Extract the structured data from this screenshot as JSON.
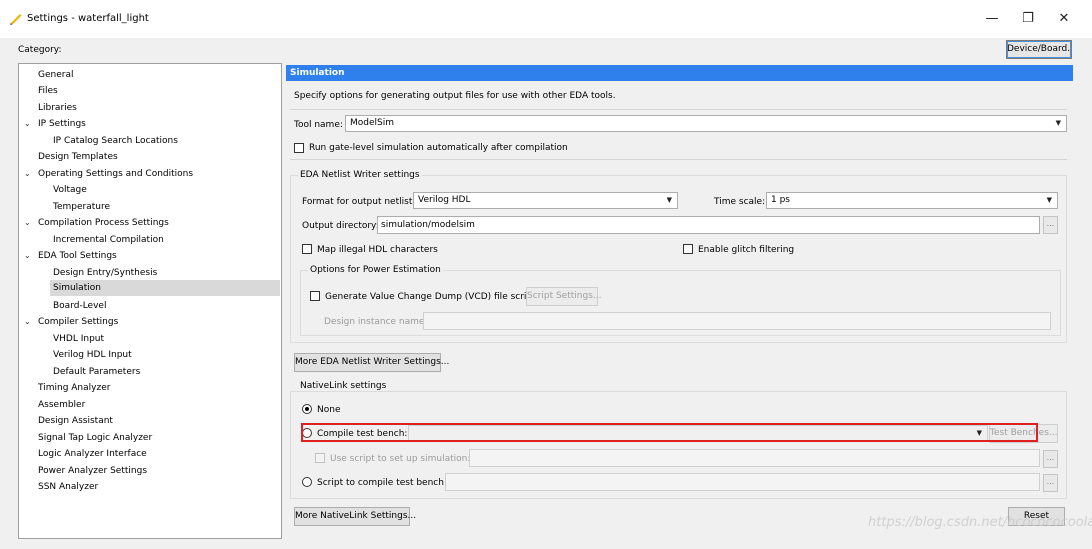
{
  "window": {
    "title": "Settings - waterfall_light",
    "minimize_glyph": "—",
    "restore_glyph": "❐",
    "close_glyph": "✕"
  },
  "category_label": "Category:",
  "device_board_button": "Device/Board...",
  "tree": {
    "items": [
      {
        "label": "General"
      },
      {
        "label": "Files"
      },
      {
        "label": "Libraries"
      },
      {
        "label": "IP Settings"
      },
      {
        "label": "IP Catalog Search Locations"
      },
      {
        "label": "Design Templates"
      },
      {
        "label": "Operating Settings and Conditions"
      },
      {
        "label": "Voltage"
      },
      {
        "label": "Temperature"
      },
      {
        "label": "Compilation Process Settings"
      },
      {
        "label": "Incremental Compilation"
      },
      {
        "label": "EDA Tool Settings"
      },
      {
        "label": "Design Entry/Synthesis"
      },
      {
        "label": "Simulation"
      },
      {
        "label": "Board-Level"
      },
      {
        "label": "Compiler Settings"
      },
      {
        "label": "VHDL Input"
      },
      {
        "label": "Verilog HDL Input"
      },
      {
        "label": "Default Parameters"
      },
      {
        "label": "Timing Analyzer"
      },
      {
        "label": "Assembler"
      },
      {
        "label": "Design Assistant"
      },
      {
        "label": "Signal Tap Logic Analyzer"
      },
      {
        "label": "Logic Analyzer Interface"
      },
      {
        "label": "Power Analyzer Settings"
      },
      {
        "label": "SSN Analyzer"
      }
    ],
    "chevron_glyph": "⌄"
  },
  "panel": {
    "header": "Simulation",
    "description": "Specify options for generating output files for use with other EDA tools.",
    "tool_name_label": "Tool name:",
    "tool_name_value": "ModelSim",
    "run_gate_level_label": "Run gate-level simulation automatically after compilation",
    "eda_netlist_group": "EDA Netlist Writer settings",
    "format_label": "Format for output netlist:",
    "format_value": "Verilog HDL",
    "time_scale_label": "Time scale:",
    "time_scale_value": "1 ps",
    "output_dir_label": "Output directory:",
    "output_dir_value": "simulation/modelsim",
    "browse_glyph": "...",
    "map_illegal_label": "Map illegal HDL characters",
    "enable_glitch_label": "Enable glitch filtering",
    "power_group": "Options for Power Estimation",
    "vcd_label": "Generate Value Change Dump (VCD) file script",
    "script_settings_button": "Script Settings...",
    "design_instance_label": "Design instance name:",
    "more_eda_button": "More EDA Netlist Writer Settings...",
    "nativelink_group": "NativeLink settings",
    "none_label": "None",
    "compile_tb_label": "Compile test bench:",
    "test_benches_button": "Test Benches...",
    "use_script_label": "Use script to set up simulation:",
    "script_compile_label": "Script to compile test bench:",
    "more_nativelink_button": "More NativeLink Settings...",
    "reset_button": "Reset"
  },
  "watermark": "https://blog.csdn.net/hcocococoola",
  "colors": {
    "header_blue": "#2f80ed",
    "highlight_red": "#e02020"
  }
}
